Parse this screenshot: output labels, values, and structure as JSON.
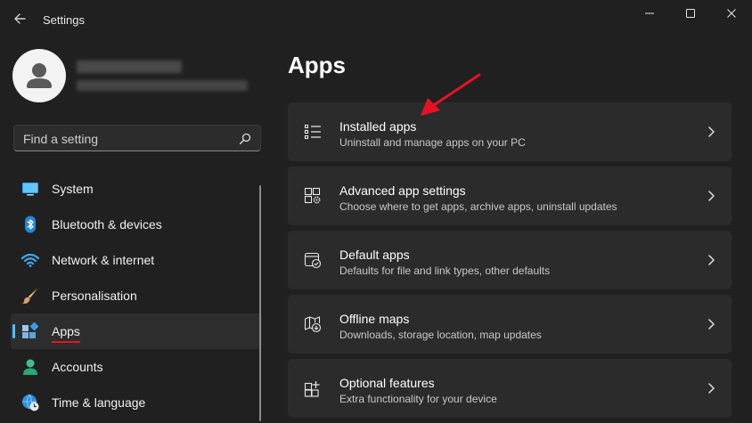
{
  "window": {
    "title": "Settings",
    "controls": [
      "minimize-icon",
      "maximize-icon",
      "close-icon"
    ]
  },
  "search": {
    "placeholder": "Find a setting",
    "icon": "search-icon"
  },
  "sidebar": {
    "items": [
      {
        "label": "System",
        "icon": "monitor-icon",
        "active": false
      },
      {
        "label": "Bluetooth & devices",
        "icon": "bluetooth-icon",
        "active": false
      },
      {
        "label": "Network & internet",
        "icon": "wifi-icon",
        "active": false
      },
      {
        "label": "Personalisation",
        "icon": "paintbrush-icon",
        "active": false
      },
      {
        "label": "Apps",
        "icon": "apps-icon",
        "active": true
      },
      {
        "label": "Accounts",
        "icon": "person-icon",
        "active": false
      },
      {
        "label": "Time & language",
        "icon": "globe-clock-icon",
        "active": false
      }
    ]
  },
  "main": {
    "title": "Apps",
    "cards": [
      {
        "title": "Installed apps",
        "subtitle": "Uninstall and manage apps on your PC",
        "icon": "list-icon"
      },
      {
        "title": "Advanced app settings",
        "subtitle": "Choose where to get apps, archive apps, uninstall updates",
        "icon": "app-settings-gear-icon"
      },
      {
        "title": "Default apps",
        "subtitle": "Defaults for file and link types, other defaults",
        "icon": "default-apps-check-icon"
      },
      {
        "title": "Offline maps",
        "subtitle": "Downloads, storage location, map updates",
        "icon": "map-download-icon"
      },
      {
        "title": "Optional features",
        "subtitle": "Extra functionality for your device",
        "icon": "optional-features-icon"
      }
    ]
  },
  "colors": {
    "background": "#202020",
    "card": "#2b2b2b",
    "accent": "#4cc2ff",
    "annotation": "#e81123"
  }
}
